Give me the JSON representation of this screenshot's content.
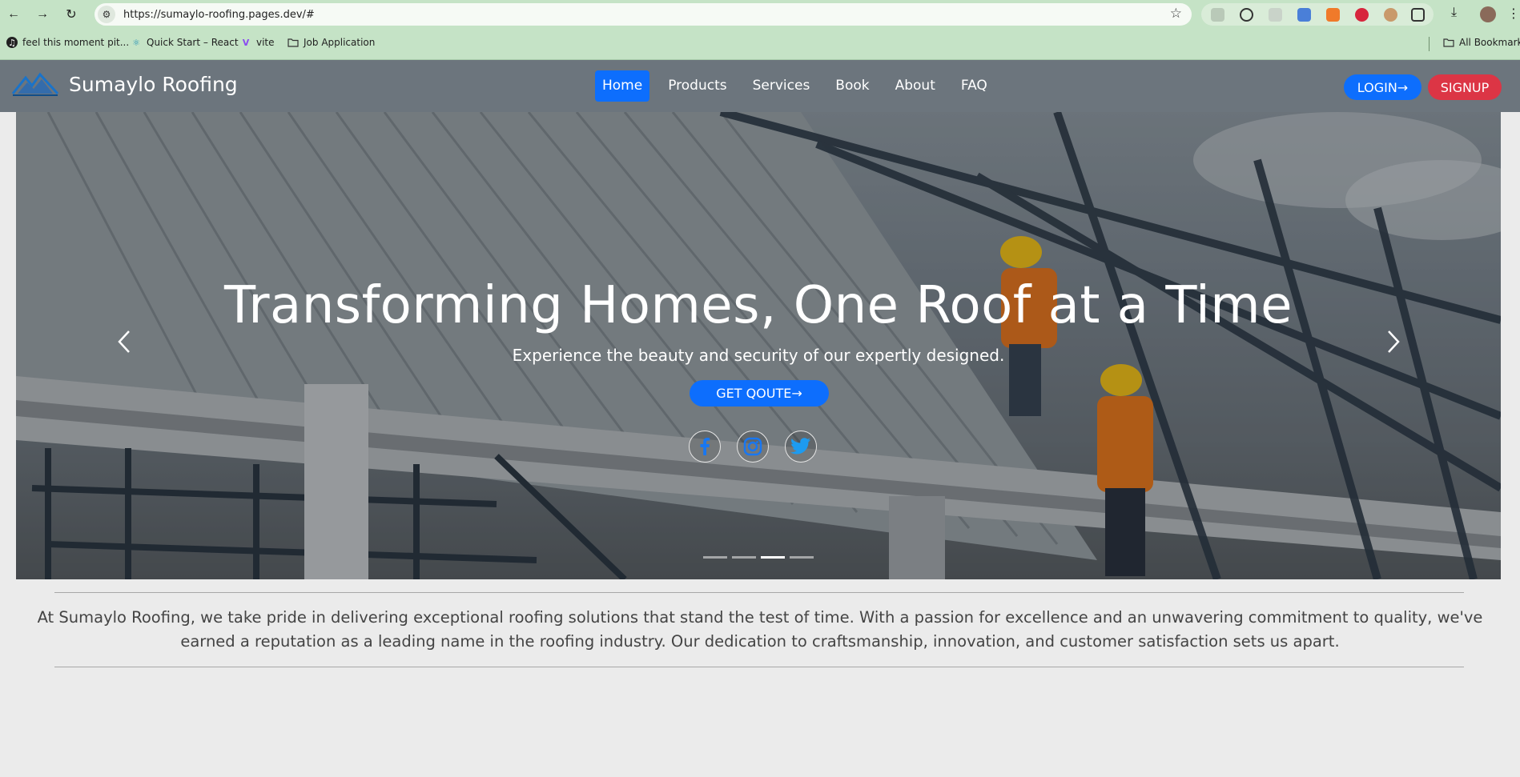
{
  "browser": {
    "url": "https://sumaylo-roofing.pages.dev/#",
    "bookmarks": [
      {
        "label": "feel this moment pit...",
        "icon": "music-icon"
      },
      {
        "label": "Quick Start – React",
        "icon": "react-icon"
      },
      {
        "label": "vite",
        "icon": "vite-icon"
      },
      {
        "label": "Job Application",
        "icon": "folder-icon"
      }
    ],
    "all_bookmarks": "All Bookmarks"
  },
  "site": {
    "brand": "Sumaylo Roofing",
    "menu": [
      "Home",
      "Products",
      "Services",
      "Book",
      "About",
      "FAQ"
    ],
    "active_menu": "Home",
    "login": "LOGIN→",
    "signup": "SIGNUP"
  },
  "hero": {
    "title": "Transforming Homes, One Roof at a Time",
    "subtitle": "Experience the beauty and security of our expertly designed.",
    "cta": "GET QOUTE→",
    "socials": [
      "facebook-icon",
      "instagram-icon",
      "twitter-icon"
    ],
    "slide_count": 4,
    "active_slide": 3
  },
  "intro": {
    "text": "At Sumaylo Roofing, we take pride in delivering exceptional roofing solutions that stand the test of time. With a passion for excellence and an unwavering commitment to quality, we've earned a reputation as a leading name in the roofing industry. Our dedication to craftsmanship, innovation, and customer satisfaction sets us apart."
  },
  "colors": {
    "primary": "#0d6efd",
    "danger": "#dc3545",
    "navbar": "#6c757d",
    "chrome": "#c5e3c6"
  }
}
